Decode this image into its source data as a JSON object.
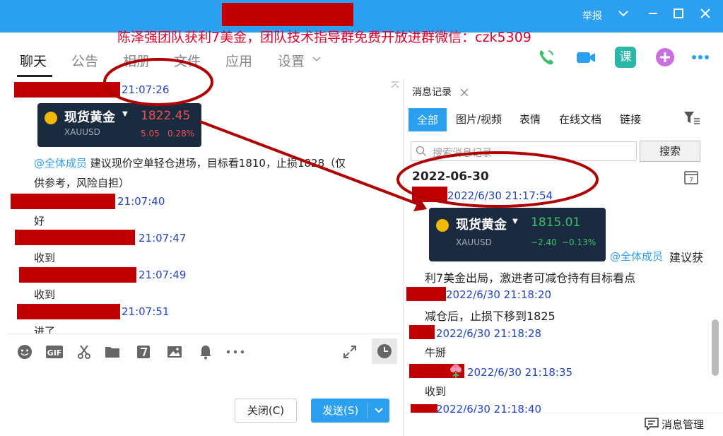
{
  "window": {
    "report_label": "举报",
    "promo_text": "陈泽强团队获利7美金，团队技术指导群免费开放进群微信：czk5309"
  },
  "tabs": [
    {
      "label": "聊天"
    },
    {
      "label": "公告"
    },
    {
      "label": "相册"
    },
    {
      "label": "文件"
    },
    {
      "label": "应用"
    },
    {
      "label": "设置"
    }
  ],
  "chat": {
    "gold_card": {
      "name": "现货黄金",
      "code": "XAUUSD",
      "price": "1822.45",
      "change": "5.05",
      "pct": "0.28%"
    },
    "messages": [
      {
        "time": "21:07:26"
      },
      {
        "mention": "@全体成员",
        "text_line1": "建议现价空单轻仓进场，目标看1810，止损1828（仅",
        "text_line2": "供参考，风险自担）"
      },
      {
        "time": "21:07:40",
        "text": "好"
      },
      {
        "time": "21:07:47",
        "text": "收到"
      },
      {
        "time": "21:07:49",
        "text": "收到"
      },
      {
        "time": "21:07:51",
        "text": "进了"
      }
    ]
  },
  "input": {
    "close_label": "关闭(C)",
    "send_label": "发送(S)"
  },
  "history": {
    "tab_label": "消息记录",
    "filters": [
      "全部",
      "图片/视频",
      "表情",
      "在线文档",
      "链接"
    ],
    "search_placeholder": "搜索消息记录",
    "search_button": "搜索",
    "date_header": "2022-06-30",
    "calendar_day": "7",
    "gold_card": {
      "name": "现货黄金",
      "code": "XAUUSD",
      "price": "1815.01",
      "change": "−2.40",
      "pct": "−0.13%"
    },
    "entries": [
      {
        "time": "2022/6/30 21:17:54"
      },
      {
        "mention": "@全体成员",
        "text_a": "建议获",
        "text_b": "利7美金出局，激进者可减仓持有目标看点"
      },
      {
        "time": "2022/6/30 21:18:20",
        "text": "减仓后，止损下移到1825"
      },
      {
        "time": "2022/6/30 21:18:28",
        "text": "牛掰"
      },
      {
        "time": "2022/6/30 21:18:35",
        "text": "收到"
      },
      {
        "time": "2022/6/30 21:18:40"
      }
    ],
    "manage_label": "消息管理"
  },
  "colors": {
    "accent": "#2b9ff0",
    "redaction": "#c00000",
    "annotation": "#b00000",
    "link_time": "#2244cc"
  }
}
